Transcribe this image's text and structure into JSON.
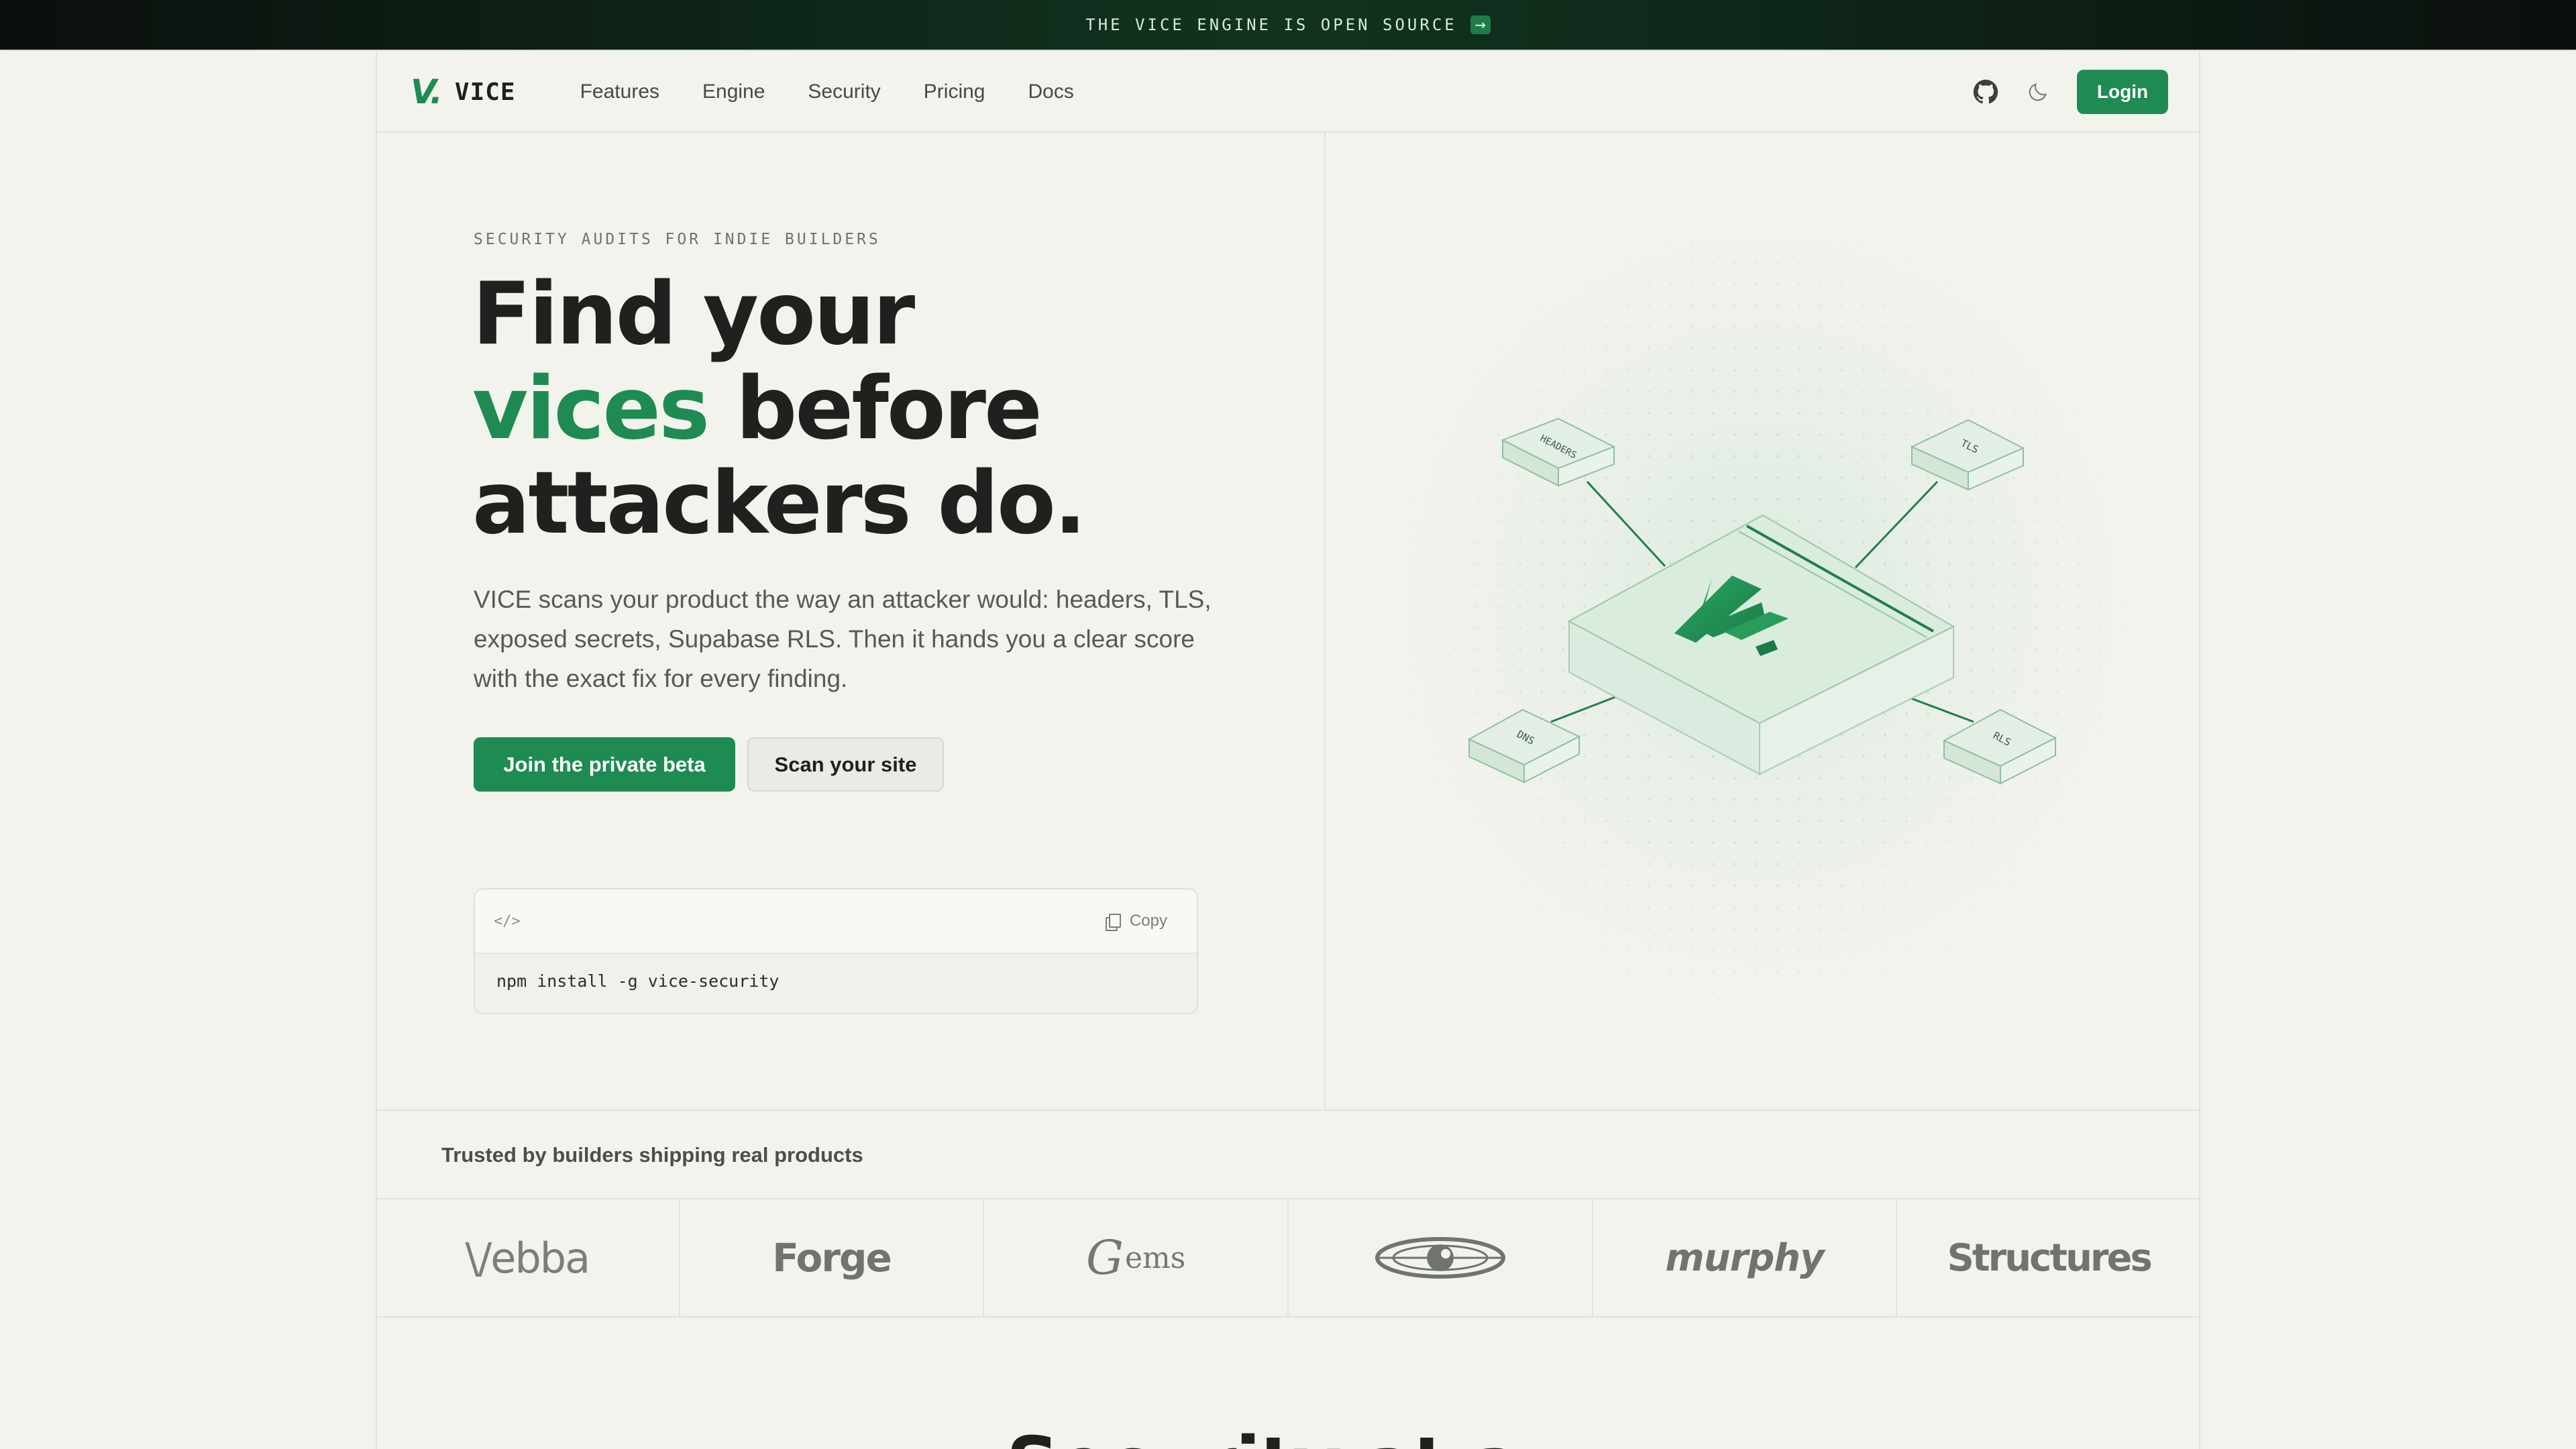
{
  "announcement": {
    "text": "THE VICE ENGINE IS OPEN SOURCE",
    "arrow": "→"
  },
  "nav": {
    "logo_mark": "V.",
    "brand": "VICE",
    "links": [
      "Features",
      "Engine",
      "Security",
      "Pricing",
      "Docs"
    ],
    "icons": [
      "github-icon",
      "moon-icon"
    ],
    "login": "Login"
  },
  "hero": {
    "eyebrow": "SECURITY AUDITS FOR INDIE BUILDERS",
    "headline_line1": "Find your",
    "headline_accent": "vices",
    "headline_line2_rest": " before",
    "headline_line3": "attackers do.",
    "subcopy": "VICE scans your product the way an attacker would: headers, TLS, exposed secrets, Supabase RLS. Then it hands you a clear score with the exact fix for every finding.",
    "primary_cta": "Join the private beta",
    "secondary_cta": "Scan your site",
    "code_icon": "</>",
    "copy_label": "Copy",
    "command": "npm install -g vice-security"
  },
  "illustration": {
    "nodes": [
      "HEADERS",
      "TLS",
      "DNS",
      "RLS"
    ],
    "center_mark": "V.",
    "accent": "#1e8b53"
  },
  "trusted": {
    "title": "Trusted by builders shipping real products",
    "logos": [
      "Webba",
      "Forge",
      "Gems",
      "eye-logo",
      "Murphy",
      "Structures"
    ],
    "logo_text": {
      "webba": "\\/ebba",
      "forge": "Forge",
      "gems_g": "G",
      "gems_rest": "ems",
      "murphy": "murphy",
      "structures": "Structures"
    }
  },
  "next_section": {
    "heading_partial": "Security at a"
  }
}
